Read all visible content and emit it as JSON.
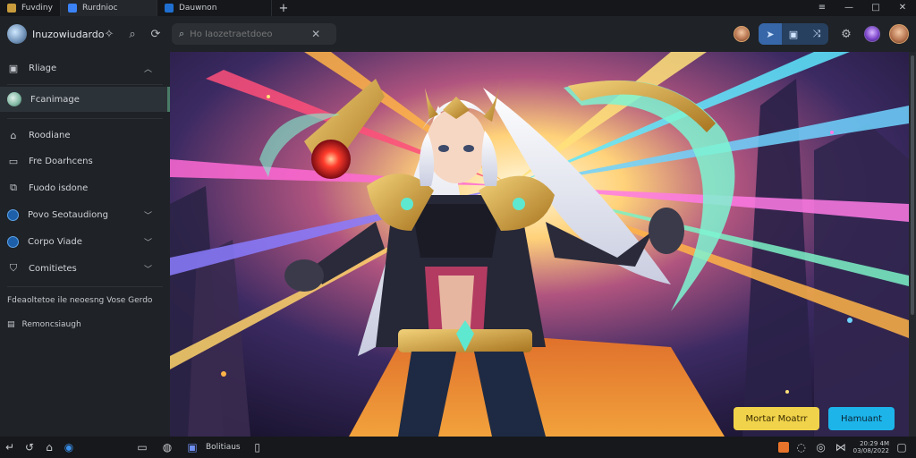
{
  "tabs": [
    {
      "label": "Fuvdiny",
      "icon": "app-icon",
      "color": "#c89b3c"
    },
    {
      "label": "Rurdnioc",
      "icon": "document-icon",
      "color": "#3b82f6",
      "active": true
    },
    {
      "label": "Dauwnon",
      "icon": "v-icon",
      "color": "#1f6fd1"
    }
  ],
  "window_controls": {
    "menu": "≡",
    "minimize": "—",
    "maximize": "□",
    "close": "✕"
  },
  "toolbar": {
    "brand_name": "Inuzowiudardo",
    "search_placeholder": "Ho Iaozetraetdoeo",
    "toggle_active": "nav",
    "accent": "#3767a8"
  },
  "sidebar": {
    "items": [
      {
        "label": "Rliage",
        "icon": "image-icon",
        "chevron": true
      },
      {
        "label": "Fcanimage",
        "icon": "avatar-icon",
        "active": true
      },
      {
        "label": "Roodiane",
        "icon": "home-icon"
      },
      {
        "label": "Fre Doarhcens",
        "icon": "folder-icon"
      },
      {
        "label": "Fuodo isdone",
        "icon": "image-stack-icon"
      },
      {
        "label": "Povo Seotaudiong",
        "icon": "v-circle-icon",
        "chevron": true
      },
      {
        "label": "Corpo Viade",
        "icon": "target-icon",
        "chevron": true
      },
      {
        "label": "Comitietes",
        "icon": "shield-icon",
        "chevron": true
      }
    ],
    "footer_line1": "Fdeaoltetoe ile neoesng Vose Gerdo",
    "footer_line2": "Remoncsiaugh"
  },
  "overlay_buttons": {
    "primary": "Mortar Moatrr",
    "secondary": "Hamuant",
    "primary_color": "#f0d34a",
    "secondary_color": "#1db4ea"
  },
  "taskbar": {
    "item_label": "Bolitiaus",
    "clock_line1": "20:29 4M",
    "clock_line2": "03/08/2022"
  }
}
